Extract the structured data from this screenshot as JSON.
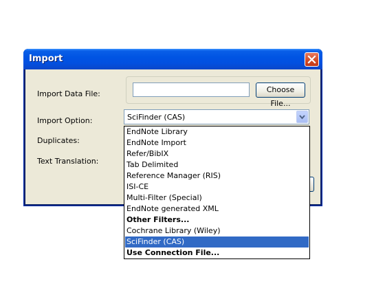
{
  "dialog": {
    "title": "Import",
    "labels": {
      "import_data_file": "Import Data File:",
      "import_option": "Import Option:",
      "duplicates": "Duplicates:",
      "text_translation": "Text Translation:"
    },
    "file_input_value": "",
    "choose_file_label": "Choose File...",
    "import_option_selected": "SciFinder (CAS)"
  },
  "dropdown": {
    "items": [
      {
        "label": "EndNote Library",
        "bold": false,
        "selected": false
      },
      {
        "label": "EndNote Import",
        "bold": false,
        "selected": false
      },
      {
        "label": "Refer/BibIX",
        "bold": false,
        "selected": false
      },
      {
        "label": "Tab Delimited",
        "bold": false,
        "selected": false
      },
      {
        "label": "Reference Manager (RIS)",
        "bold": false,
        "selected": false
      },
      {
        "label": "ISI-CE",
        "bold": false,
        "selected": false
      },
      {
        "label": "Multi-Filter (Special)",
        "bold": false,
        "selected": false
      },
      {
        "label": "EndNote generated XML",
        "bold": false,
        "selected": false
      },
      {
        "label": "Other Filters...",
        "bold": true,
        "selected": false
      },
      {
        "label": "Cochrane Library (Wiley)",
        "bold": false,
        "selected": false
      },
      {
        "label": "SciFinder (CAS)",
        "bold": false,
        "selected": true
      },
      {
        "label": "Use Connection File...",
        "bold": true,
        "selected": false
      }
    ]
  },
  "colors": {
    "titlebar": "#0054e3",
    "dialog_bg": "#ece9d8",
    "selection": "#316ac5",
    "close_button": "#d04a23"
  },
  "icons": {
    "close": "close-icon",
    "dropdown_arrow": "chevron-down-icon"
  }
}
